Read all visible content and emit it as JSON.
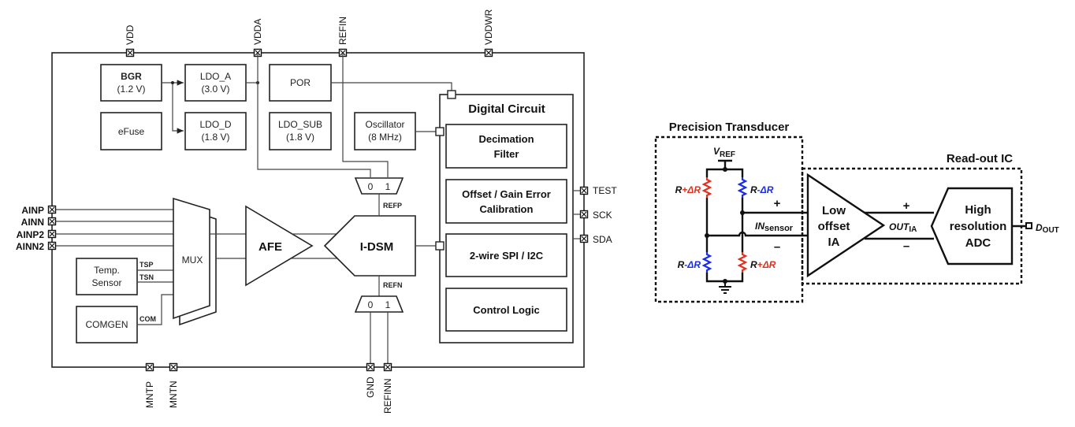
{
  "left_diagram": {
    "top_pins": [
      "VDD",
      "VDDA",
      "REFIN",
      "VDDWR"
    ],
    "bottom_pins": [
      "MNTP",
      "MNTN",
      "GND",
      "REFINN"
    ],
    "left_pins": [
      "AINP",
      "AINN",
      "AINP2",
      "AINN2"
    ],
    "right_pins": [
      "TEST",
      "SCK",
      "SDA"
    ],
    "blocks": {
      "bgr": [
        "BGR",
        "(1.2 V)"
      ],
      "ldo_a": [
        "LDO_A",
        "(3.0 V)"
      ],
      "efuse": "eFuse",
      "ldo_d": [
        "LDO_D",
        "(1.8 V)"
      ],
      "por": "POR",
      "ldo_sub": [
        "LDO_SUB",
        "(1.8 V)"
      ],
      "oscillator": [
        "Oscillator",
        "(8 MHz)"
      ],
      "temp_sensor": [
        "Temp.",
        "Sensor"
      ],
      "comgen": "COMGEN",
      "mux": "MUX",
      "afe": "AFE",
      "idsm": "I-DSM"
    },
    "signals": {
      "tsp": "TSP",
      "tsn": "TSN",
      "com": "COM",
      "refp": "REFP",
      "refn": "REFN",
      "mux_sel_0": "0",
      "mux_sel_1": "1"
    },
    "digital_circuit": {
      "title": "Digital Circuit",
      "blocks": [
        [
          "Decimation",
          "Filter"
        ],
        [
          "Offset / Gain Error",
          "Calibration"
        ],
        [
          "2-wire SPI / I2C"
        ],
        [
          "Control Logic"
        ]
      ]
    }
  },
  "right_diagram": {
    "transducer_title": "Precision Transducer",
    "readout_title": "Read-out IC",
    "vref": {
      "main": "V",
      "sub": "REF"
    },
    "resistors": {
      "r": "R",
      "plus": "+",
      "minus": "-",
      "delta_r": "ΔR"
    },
    "in_sensor": {
      "main": "IN",
      "sub": "sensor"
    },
    "plus_sign": "+",
    "minus_sign": "–",
    "ia": [
      "Low",
      "offset",
      "IA"
    ],
    "out_ia": {
      "main": "OUT",
      "sub": "IA"
    },
    "adc": [
      "High",
      "resolution",
      "ADC"
    ],
    "dout": {
      "main": "D",
      "sub": "OUT"
    },
    "colors": {
      "increase": "#e0301e",
      "decrease": "#1a2be8"
    }
  }
}
